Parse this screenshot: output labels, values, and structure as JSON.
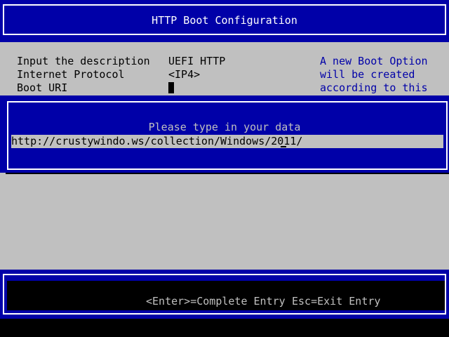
{
  "header": {
    "title": "HTTP Boot Configuration"
  },
  "form": {
    "fields": [
      {
        "label": "Input the description",
        "value": "UEFI HTTP"
      },
      {
        "label": "Internet Protocol",
        "value": "<IP4>"
      },
      {
        "label": "Boot URI",
        "value": ""
      }
    ],
    "help_lines": [
      "A new Boot Option",
      "will be created",
      "according to this"
    ]
  },
  "popup": {
    "prompt": "Please type in your data",
    "input_value": "http://crustywindo.ws/collection/Windows/2011/"
  },
  "footer": {
    "enter_hint": "<Enter>=Complete Entry",
    "esc_hint": "Esc=Exit Entry"
  },
  "colors": {
    "background": "#000000",
    "panel_blue": "#0000a8",
    "form_gray": "#c0c0c0",
    "help_text": "#0000a8",
    "border_white": "#ffffff"
  }
}
